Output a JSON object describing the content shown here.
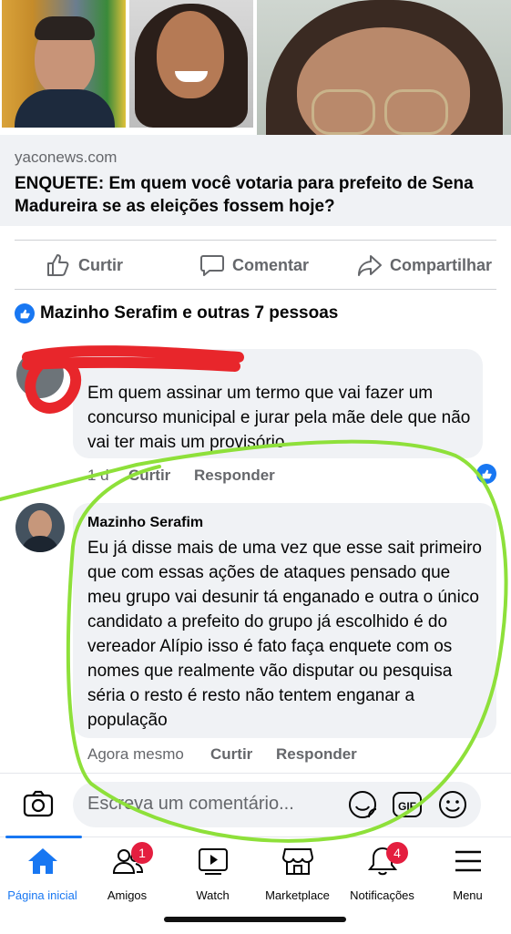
{
  "post": {
    "link_domain": "yaconews.com",
    "link_title": "ENQUETE: Em quem você votaria para prefeito de Sena Madureira se as eleições fossem hoje?"
  },
  "actions": {
    "like": "Curtir",
    "comment": "Comentar",
    "share": "Compartilhar"
  },
  "reactions": {
    "text": "Mazinho Serafim e outras 7 pessoas"
  },
  "comments": [
    {
      "name": "",
      "text": "Em quem assinar um termo que vai fazer um concurso municipal e jurar pela mãe dele que não vai ter mais um provisório",
      "time": "1 d",
      "like": "Curtir",
      "reply": "Responder"
    },
    {
      "name": "Mazinho Serafim",
      "text": "Eu já disse mais de uma vez que esse sait primeiro que com essas ações de ataques pensado que meu grupo vai desunir tá enganado e outra o único candidato a prefeito do grupo já escolhido é do vereador Alípio isso é fato faça enquete com os nomes que realmente vão disputar ou pesquisa séria o resto é resto não tentem enganar a população",
      "time": "Agora mesmo",
      "like": "Curtir",
      "reply": "Responder"
    }
  ],
  "composer": {
    "placeholder": "Escreva um comentário..."
  },
  "tabs": [
    {
      "label": "Página inicial",
      "icon": "home-icon",
      "badge": ""
    },
    {
      "label": "Amigos",
      "icon": "friends-icon",
      "badge": "1"
    },
    {
      "label": "Watch",
      "icon": "watch-icon",
      "badge": ""
    },
    {
      "label": "Marketplace",
      "icon": "marketplace-icon",
      "badge": ""
    },
    {
      "label": "Notificações",
      "icon": "bell-icon",
      "badge": "4"
    },
    {
      "label": "Menu",
      "icon": "menu-icon",
      "badge": ""
    }
  ],
  "colors": {
    "accent": "#1877f2",
    "badge": "#e41e3f",
    "annotation_green": "#8ee03a",
    "annotation_red": "#e8262b"
  }
}
